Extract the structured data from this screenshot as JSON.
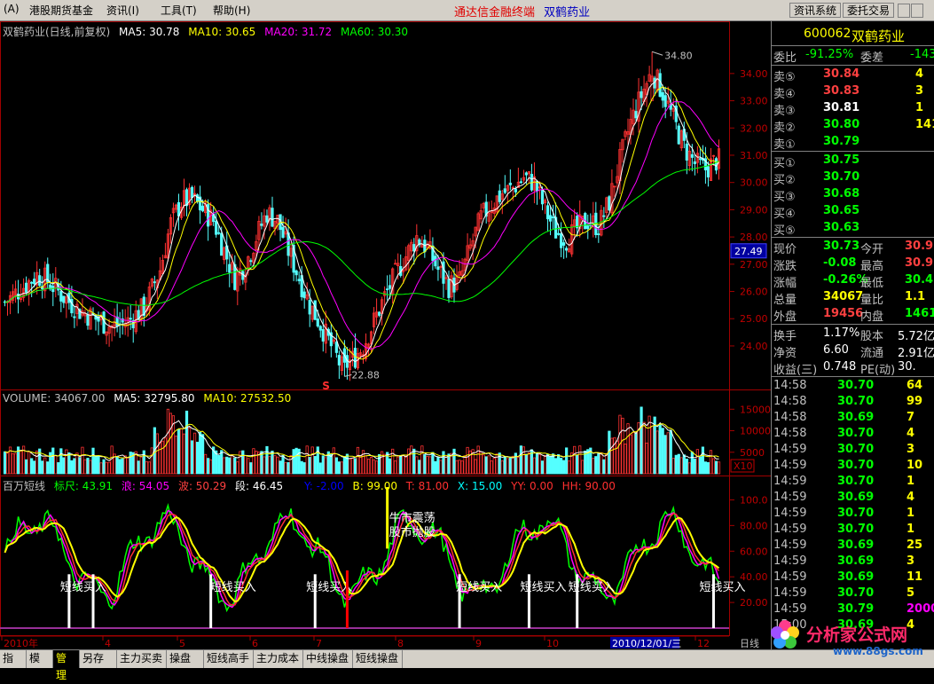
{
  "menu": {
    "items": [
      "(A)",
      "港股期货基金",
      "资讯(I)",
      "工具(T)",
      "帮助(H)"
    ],
    "title_main": "通达信金融终端",
    "title_stock": "双鹤药业",
    "buttons": [
      "资讯系统",
      "委托交易"
    ]
  },
  "price_pane": {
    "title": "双鹤药业(日线,前复权)",
    "ma": [
      {
        "label": "MA5: 30.78",
        "color": "#ffffff"
      },
      {
        "label": "MA10: 30.65",
        "color": "#ffff00"
      },
      {
        "label": "MA20: 31.72",
        "color": "#ff00ff"
      },
      {
        "label": "MA60: 30.30",
        "color": "#00ff00"
      }
    ],
    "y_labels": [
      "34.00",
      "33.00",
      "32.00",
      "31.00",
      "30.00",
      "29.00",
      "28.00",
      "27.00",
      "26.00",
      "25.00",
      "24.00"
    ],
    "high_label": "34.80",
    "low_label": "22.88",
    "current_tag": "27.49",
    "s_marker": "S"
  },
  "volume_pane": {
    "title": "VOLUME: 34067.00",
    "ma5": "MA5: 32795.80",
    "ma10": "MA10: 27532.50",
    "y_labels": [
      "15000",
      "10000",
      "5000"
    ],
    "unit": "X10"
  },
  "indicator_pane": {
    "name": "百万短线",
    "params": [
      {
        "label": "标尺: 43.91",
        "color": "#00ff00"
      },
      {
        "label": "浪: 54.05",
        "color": "#ff00ff"
      },
      {
        "label": "波: 50.29",
        "color": "#ff4040"
      },
      {
        "label": "段: 46.45",
        "color": "#ffffff"
      },
      {
        "label": "Y: -2.00",
        "color": "#0000ff"
      },
      {
        "label": "B: 99.00",
        "color": "#ffff00"
      },
      {
        "label": "T: 81.00",
        "color": "#ff3030"
      },
      {
        "label": "X: 15.00",
        "color": "#00ffff"
      },
      {
        "label": "YY: 0.00",
        "color": "#ff3030"
      },
      {
        "label": "HH: 90.00",
        "color": "#ff3030"
      }
    ],
    "y_labels": [
      "100.0",
      "80.00",
      "60.00",
      "40.00",
      "20.00"
    ],
    "buy_label": "短线买入",
    "sell_label_1": "牛市震荡",
    "sell_label_2": "股市抛股"
  },
  "x_axis": {
    "labels": [
      "2010年",
      "4",
      "5",
      "6",
      "7",
      "8",
      "9",
      "10",
      "11",
      "12"
    ],
    "date_box": "2010/12/01/三",
    "corner_label": "日线"
  },
  "sidebar": {
    "code": "600062",
    "name": "双鹤药业",
    "weibi_label": "委比",
    "weibi_value": "-91.25%",
    "weicha_label": "委差",
    "weicha_value": "-143",
    "asks": [
      {
        "label": "卖⑤",
        "price": "30.84",
        "vol": "4",
        "color": "#ff4040"
      },
      {
        "label": "卖④",
        "price": "30.83",
        "vol": "3",
        "color": "#ff4040"
      },
      {
        "label": "卖③",
        "price": "30.81",
        "vol": "1",
        "color": "#ffffff"
      },
      {
        "label": "卖②",
        "price": "30.80",
        "vol": "141",
        "color": "#00ff00"
      },
      {
        "label": "卖①",
        "price": "30.79",
        "vol": "",
        "color": "#00ff00"
      }
    ],
    "bids": [
      {
        "label": "买①",
        "price": "30.75",
        "vol": "",
        "color": "#00ff00"
      },
      {
        "label": "买②",
        "price": "30.70",
        "vol": "",
        "color": "#00ff00"
      },
      {
        "label": "买③",
        "price": "30.68",
        "vol": "",
        "color": "#00ff00"
      },
      {
        "label": "买④",
        "price": "30.65",
        "vol": "",
        "color": "#00ff00"
      },
      {
        "label": "买⑤",
        "price": "30.63",
        "vol": "",
        "color": "#00ff00"
      }
    ],
    "stats": [
      {
        "l1": "现价",
        "v1": "30.73",
        "c1": "#00ff00",
        "l2": "今开",
        "v2": "30.9",
        "c2": "#ff4040"
      },
      {
        "l1": "涨跌",
        "v1": "-0.08",
        "c1": "#00ff00",
        "l2": "最高",
        "v2": "30.9",
        "c2": "#ff4040"
      },
      {
        "l1": "涨幅",
        "v1": "-0.26%",
        "c1": "#00ff00",
        "l2": "最低",
        "v2": "30.4",
        "c2": "#00ff00"
      },
      {
        "l1": "总量",
        "v1": "34067",
        "c1": "#ffff00",
        "l2": "量比",
        "v2": "1.1",
        "c2": "#ffff00"
      },
      {
        "l1": "外盘",
        "v1": "19456",
        "c1": "#ff4040",
        "l2": "内盘",
        "v2": "1461",
        "c2": "#00ff00"
      }
    ],
    "stats2": [
      {
        "l1": "换手",
        "v1": "1.17%",
        "l2": "股本",
        "v2": "5.72亿"
      },
      {
        "l1": "净资",
        "v1": "6.60",
        "l2": "流通",
        "v2": "2.91亿"
      },
      {
        "l1": "收益(三)",
        "v1": "0.748",
        "l2": "PE(动)",
        "v2": "30."
      }
    ],
    "ticks": [
      {
        "time": "14:58",
        "price": "30.70",
        "vol": "64",
        "color": "#ffff00"
      },
      {
        "time": "14:58",
        "price": "30.70",
        "vol": "99",
        "color": "#ffff00"
      },
      {
        "time": "14:58",
        "price": "30.69",
        "vol": "7",
        "color": "#ffff00"
      },
      {
        "time": "14:58",
        "price": "30.70",
        "vol": "4",
        "color": "#ffff00"
      },
      {
        "time": "14:59",
        "price": "30.70",
        "vol": "3",
        "color": "#ffff00"
      },
      {
        "time": "14:59",
        "price": "30.70",
        "vol": "10",
        "color": "#ffff00"
      },
      {
        "time": "14:59",
        "price": "30.70",
        "vol": "1",
        "color": "#ffff00"
      },
      {
        "time": "14:59",
        "price": "30.69",
        "vol": "4",
        "color": "#ffff00"
      },
      {
        "time": "14:59",
        "price": "30.70",
        "vol": "1",
        "color": "#ffff00"
      },
      {
        "time": "14:59",
        "price": "30.70",
        "vol": "1",
        "color": "#ffff00"
      },
      {
        "time": "14:59",
        "price": "30.69",
        "vol": "25",
        "color": "#ffff00"
      },
      {
        "time": "14:59",
        "price": "30.69",
        "vol": "3",
        "color": "#ffff00"
      },
      {
        "time": "14:59",
        "price": "30.69",
        "vol": "11",
        "color": "#ffff00"
      },
      {
        "time": "14:59",
        "price": "30.70",
        "vol": "5",
        "color": "#ffff00"
      },
      {
        "time": "14:59",
        "price": "30.79",
        "vol": "2000",
        "color": "#ff00ff"
      },
      {
        "time": "15:00",
        "price": "30.69",
        "vol": "4",
        "color": "#ffff00"
      }
    ]
  },
  "bottom_tabs": [
    "指标",
    "模板",
    "管理",
    "另存为",
    "主力买卖",
    "操盘手",
    "短线高手",
    "主力成本",
    "中线操盘",
    "短线操盘"
  ],
  "watermark": {
    "name": "分析家公式网",
    "url": "www.88gs.com"
  },
  "chart_data": {
    "type": "candlestick",
    "title": "双鹤药业(日线,前复权)",
    "x_tick_labels": [
      "2010年",
      "4",
      "5",
      "6",
      "7",
      "8",
      "9",
      "10",
      "11",
      "12"
    ],
    "y_range": [
      22.5,
      35.2
    ],
    "price_path": [
      [
        0,
        25.6
      ],
      [
        6,
        26.1
      ],
      [
        12,
        26.6
      ],
      [
        16,
        26.4
      ],
      [
        22,
        25.8
      ],
      [
        28,
        25.3
      ],
      [
        34,
        25.0
      ],
      [
        40,
        24.7
      ],
      [
        46,
        24.9
      ],
      [
        52,
        25.4
      ],
      [
        58,
        26.8
      ],
      [
        62,
        28.5
      ],
      [
        66,
        29.3
      ],
      [
        70,
        29.4
      ],
      [
        74,
        29.0
      ],
      [
        78,
        28.6
      ],
      [
        82,
        27.5
      ],
      [
        86,
        26.5
      ],
      [
        90,
        27.0
      ],
      [
        94,
        28.0
      ],
      [
        98,
        28.9
      ],
      [
        102,
        28.6
      ],
      [
        106,
        27.5
      ],
      [
        110,
        26.5
      ],
      [
        114,
        25.5
      ],
      [
        118,
        24.8
      ],
      [
        122,
        24.0
      ],
      [
        126,
        23.2
      ],
      [
        130,
        23.5
      ],
      [
        134,
        24.0
      ],
      [
        138,
        24.9
      ],
      [
        142,
        25.8
      ],
      [
        146,
        26.6
      ],
      [
        150,
        27.3
      ],
      [
        154,
        28.0
      ],
      [
        158,
        27.6
      ],
      [
        162,
        26.8
      ],
      [
        166,
        26.2
      ],
      [
        170,
        26.4
      ],
      [
        174,
        27.6
      ],
      [
        178,
        28.7
      ],
      [
        182,
        29.2
      ],
      [
        186,
        29.6
      ],
      [
        190,
        29.8
      ],
      [
        194,
        30.2
      ],
      [
        198,
        30.0
      ],
      [
        202,
        29.0
      ],
      [
        206,
        28.2
      ],
      [
        210,
        27.9
      ],
      [
        214,
        28.3
      ],
      [
        218,
        28.6
      ],
      [
        222,
        28.4
      ],
      [
        226,
        29.3
      ],
      [
        230,
        30.8
      ],
      [
        234,
        32.2
      ],
      [
        238,
        33.2
      ],
      [
        242,
        34.1
      ],
      [
        246,
        33.3
      ],
      [
        250,
        32.3
      ],
      [
        254,
        31.3
      ],
      [
        258,
        30.7
      ],
      [
        262,
        30.5
      ],
      [
        266,
        30.8
      ]
    ],
    "ma5_endpoint": 30.78,
    "ma10_endpoint": 30.65,
    "ma20_endpoint": 31.72,
    "ma60_endpoint": 30.3,
    "high": 34.8,
    "low": 22.88,
    "volume_range": [
      0,
      16500
    ],
    "volume_ma5": 32795.8,
    "volume_ma10": 27532.5,
    "volume_last": 34067.0,
    "indicator_range": [
      0,
      110
    ],
    "buy_signal_bars": [
      24,
      33,
      77,
      116,
      170,
      196,
      214,
      265
    ],
    "sell_signal_bar": 143
  }
}
